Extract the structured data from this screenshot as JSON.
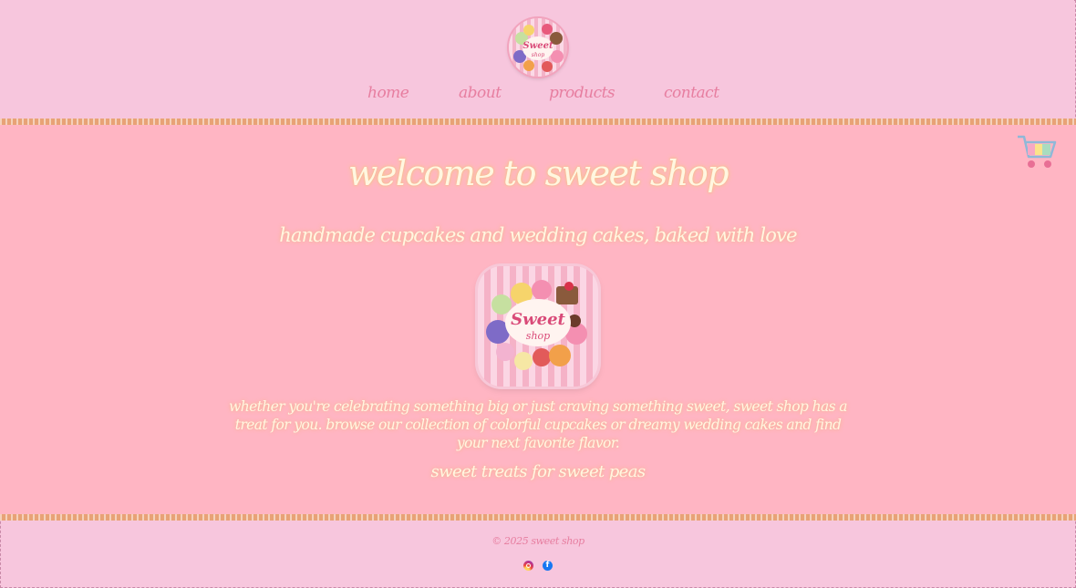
{
  "header": {
    "logo_alt": "Sweet shop",
    "nav": [
      {
        "label": "home"
      },
      {
        "label": "about"
      },
      {
        "label": "products"
      },
      {
        "label": "contact"
      }
    ]
  },
  "logo": {
    "word1": "Sweet",
    "word2": "shop"
  },
  "main": {
    "title": "welcome to sweet shop",
    "subtitle": "handmade cupcakes and wedding cakes, baked with love",
    "description": "whether you're celebrating something big or just craving something sweet, sweet shop has a treat for you. browse our collection of colorful cupcakes or dreamy wedding cakes and find your next favorite flavor.",
    "tagline": "sweet treats for sweet peas"
  },
  "footer": {
    "copyright": "© 2025 sweet shop",
    "social": [
      {
        "icon": "instagram-icon"
      },
      {
        "icon": "facebook-icon"
      }
    ]
  },
  "colors": {
    "header_bg": "#f7c6dd",
    "main_bg": "#ffb5c3",
    "nav_text": "#e77ea0",
    "heading_text": "#fff7e0",
    "stripe": "#e8a276"
  }
}
